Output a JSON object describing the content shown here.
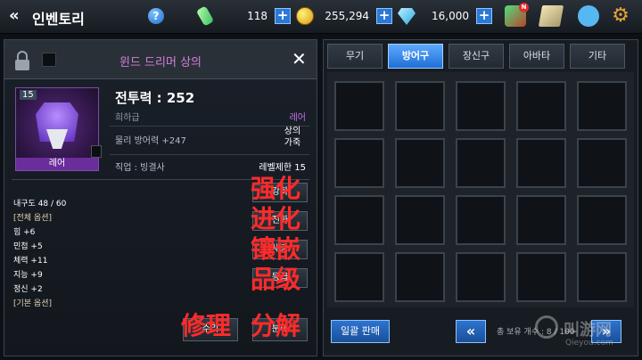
{
  "header": {
    "back_icon": "double-chevron-left-icon",
    "title": "인벤토리",
    "help_icon": "question-icon",
    "stamina": "118",
    "gold": "255,294",
    "gems": "16,000",
    "notification_badge": "N"
  },
  "item": {
    "name": "윈드 드리머 상의",
    "level": "15",
    "rarity_strip": "레어",
    "power_label": "전투력 : 252",
    "grade": "희하급",
    "rarity": "레어",
    "base_stat": "물리 방어력 +247",
    "type": "상의 가죽",
    "class_req": "직업 : 빙결사",
    "level_req": "레벨제한 15"
  },
  "attributes": [
    "내구도 48 / 60",
    "[전체 옵션]",
    "힘 +6",
    "민첩 +5",
    "체력 +11",
    "지능 +9",
    "정신 +2",
    "[기본 옵션]"
  ],
  "actions": [
    "강화",
    "진화",
    "세공",
    "등급"
  ],
  "bottom_actions": [
    "수리",
    "분해"
  ],
  "overlay_labels": [
    "强化",
    "进化",
    "镶嵌",
    "品级",
    "修理",
    "分解"
  ],
  "tabs": [
    "무기",
    "방어구",
    "장신구",
    "아바타",
    "기타"
  ],
  "active_tab": "방어구",
  "inventory": {
    "sell_all": "일괄 판매",
    "capacity": "총 보유 개수 : 8 / 100",
    "prev": "«",
    "next": "»"
  },
  "watermark": {
    "brand": "叫游网",
    "url": "Qieyou.com"
  },
  "colors": {
    "accent": "#1f6fd6",
    "rarity": "#c773ea",
    "overlay": "#ff2a2a"
  }
}
